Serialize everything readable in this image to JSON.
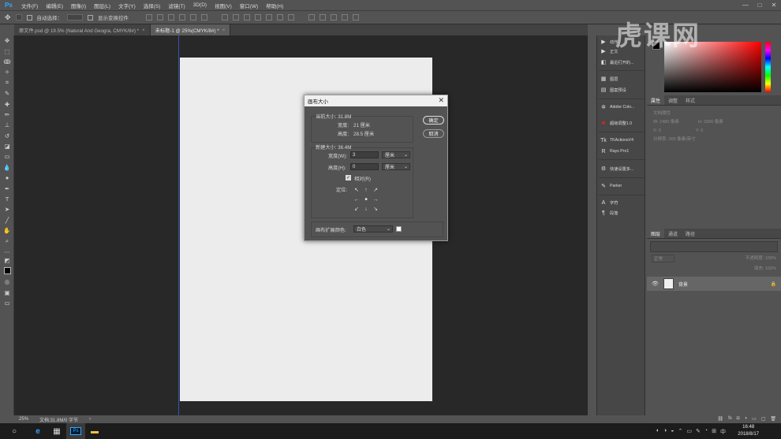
{
  "app": {
    "logo": "Ps"
  },
  "menu": [
    "文件(F)",
    "编辑(E)",
    "图像(I)",
    "图层(L)",
    "文字(Y)",
    "选择(S)",
    "滤镜(T)",
    "3D(D)",
    "视图(V)",
    "窗口(W)",
    "帮助(H)"
  ],
  "window_controls": {
    "minimize": "—",
    "maximize": "□",
    "close": "✕"
  },
  "options_bar": {
    "auto_select_label": "自动选择：",
    "show_transform_label": "显示变换控件"
  },
  "tabs": [
    {
      "label": "原文件.psd @ 19.5% (Natural And Geogra, CMYK/8#) *",
      "close": "×"
    },
    {
      "label": "未标题-1 @ 25%(CMYK/8#) *",
      "close": "×"
    }
  ],
  "status": {
    "zoom": "25%",
    "doc_info": "文档:31.8M/0 字节",
    "arrow": "›"
  },
  "dialog": {
    "title": "画布大小",
    "close": "✕",
    "current_size_label": "当前大小: 31.8M",
    "current_width_label": "宽度:",
    "current_width_value": "21 厘米",
    "current_height_label": "高度:",
    "current_height_value": "28.5 厘米",
    "new_size_label": "新建大小: 36.4M",
    "width_label": "宽度(W):",
    "width_value": "3",
    "height_label": "高度(H):",
    "height_value": "0",
    "unit": "厘米",
    "relative_label": "相对(R)",
    "relative_checked": true,
    "anchor_label": "定位:",
    "anchor_arrows": [
      "↖",
      "↑",
      "↗",
      "←",
      "■",
      "→",
      "↙",
      "↓",
      "↘"
    ],
    "extension_color_label": "画布扩展颜色:",
    "extension_color_value": "白色",
    "ok_label": "确定",
    "cancel_label": "取消"
  },
  "mid_panel": {
    "items": [
      {
        "icon": "▶",
        "label": "动作",
        "dim": false
      },
      {
        "icon": "▶",
        "label": "正文",
        "dim": false
      },
      {
        "icon": "◧",
        "label": "最近打开的...",
        "dim": false
      },
      {
        "icon": "▦",
        "label": "图层",
        "dim": false
      },
      {
        "icon": "▤",
        "label": "图案预设",
        "dim": false
      },
      {
        "icon": "✲",
        "label": "Adobe Colo...",
        "dim": false
      },
      {
        "icon": "■",
        "label": "超级调整1.0",
        "dim": false
      },
      {
        "icon": "Tk",
        "label": "TKActionsV4",
        "dim": false
      },
      {
        "icon": "R",
        "label": "Rays Pro1",
        "dim": false
      },
      {
        "icon": "⚙",
        "label": "快速设置多...",
        "dim": false
      },
      {
        "icon": "✎",
        "label": "Parker",
        "dim": false
      },
      {
        "icon": "A",
        "label": "字符",
        "dim": false
      },
      {
        "icon": "¶",
        "label": "段落",
        "dim": false
      }
    ]
  },
  "color_panel": {
    "fg": "#000000",
    "bg": "#ffffff"
  },
  "properties_panel": {
    "tabs": [
      "属性",
      "调整",
      "样式"
    ],
    "doc_props_label": "文档属性",
    "w_label": "W: 2480 像素",
    "h_label": "H: 3366 像素",
    "x_label": "X: 0",
    "y_label": "Y: 0",
    "res_label": "分辨率: 300 像素/英寸"
  },
  "layers_panel": {
    "tabs": [
      "图层",
      "通道",
      "路径"
    ],
    "blend_mode": "正常",
    "opacity_label": "不透明度: 100%",
    "fill_label": "填充: 100%",
    "layer_name": "背景",
    "lock_icon": "🔒"
  },
  "taskbar": {
    "time": "16:48",
    "date": "2018/8/17",
    "start_icon": "○",
    "ie_icon": "e",
    "calc_icon": "▦",
    "ps_icon": "Ps",
    "folder_icon": "▬"
  },
  "tray": [
    "◐",
    "◑",
    "◒",
    "⌃",
    "▭",
    "✎",
    "◔",
    "⊞",
    "中"
  ],
  "watermark": "虎课网"
}
